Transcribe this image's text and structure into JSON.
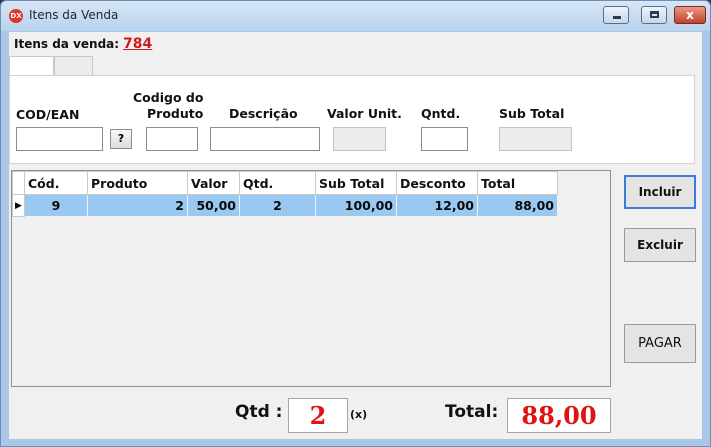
{
  "window": {
    "title": "Itens da Venda",
    "close_glyph": "x"
  },
  "header": {
    "itens_label": "Itens da venda:",
    "itens_value": "784"
  },
  "form": {
    "cod_ean_label": "COD/EAN",
    "help_button": "?",
    "codigo_produto_label_line1": "Codigo do",
    "codigo_produto_label_line2": "Produto",
    "descricao_label": "Descrição",
    "valor_unit_label": "Valor Unit.",
    "qntd_label": "Qntd.",
    "sub_total_label": "Sub Total"
  },
  "grid": {
    "columns": [
      "Cód.",
      "Produto",
      "Valor",
      "Qtd.",
      "Sub Total",
      "Desconto",
      "Total"
    ],
    "rows": [
      {
        "indicator": "▶",
        "cod": "9",
        "produto": "2",
        "valor": "50,00",
        "qtd": "2",
        "sub_total": "100,00",
        "desconto": "12,00",
        "total": "88,00"
      }
    ]
  },
  "buttons": {
    "incluir": "Incluir",
    "excluir": "Excluir",
    "pagar": "PAGAR"
  },
  "footer": {
    "qtd_label": "Qtd :",
    "qtd_value": "2",
    "x_label": "(x)",
    "total_label": "Total:",
    "total_value": "88,00"
  },
  "colors": {
    "accent_red": "#e01212",
    "row_selected": "#99c9f1",
    "window_frame": "#a9c7e6"
  }
}
